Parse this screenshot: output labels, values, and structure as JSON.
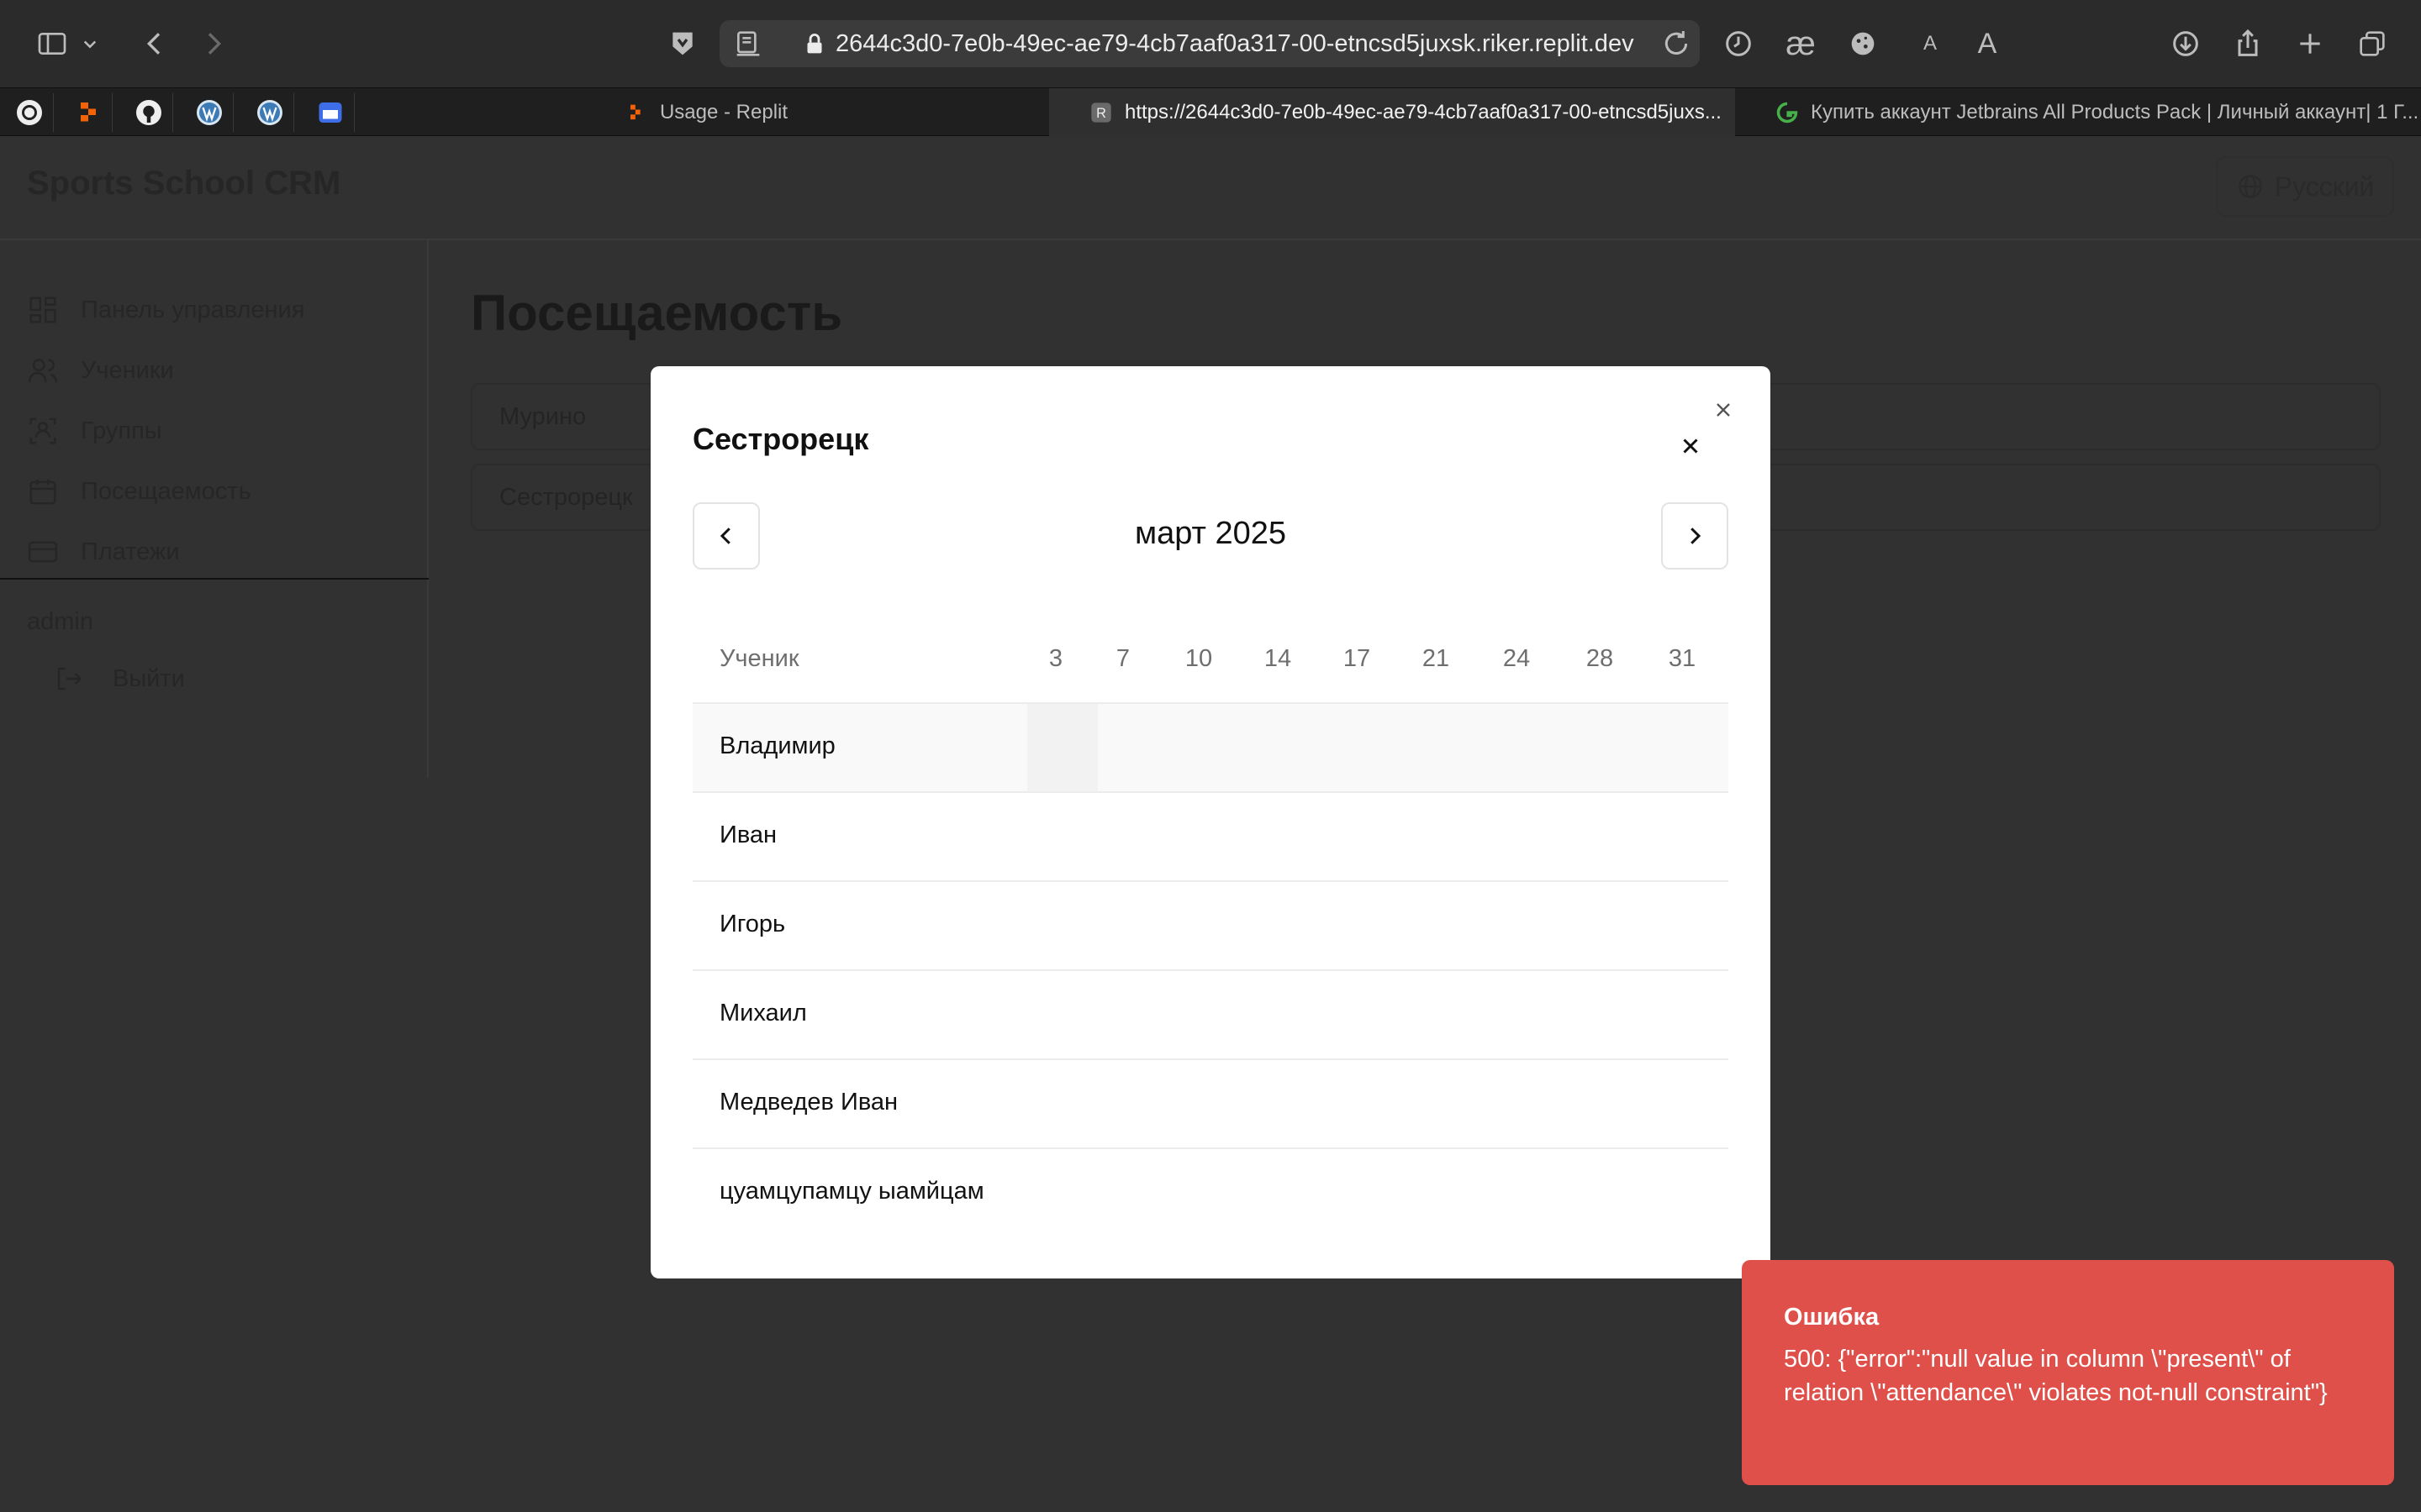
{
  "browser": {
    "url": "2644c3d0-7e0b-49ec-ae79-4cb7aaf0a317-00-etncsd5juxsk.riker.replit.dev",
    "tabs": [
      {
        "title": "Usage - Replit",
        "active": false
      },
      {
        "title": "https://2644c3d0-7e0b-49ec-ae79-4cb7aaf0a317-00-etncsd5juxs...",
        "active": true
      },
      {
        "title": "Купить аккаунт Jetbrains All Products Pack | Личный аккаунт| 1 Г...",
        "active": false
      }
    ],
    "toolbar_icons": [
      "sidebar-toggle-icon",
      "chevron-down-icon",
      "back-icon",
      "forward-icon",
      "shield-extension-icon",
      "reader-icon",
      "lock-icon",
      "reload-icon",
      "history-icon",
      "ae-extension-icon",
      "cookie-icon",
      "font-small-icon",
      "font-large-icon",
      "download-icon",
      "share-icon",
      "new-tab-icon",
      "tab-overview-icon"
    ],
    "text_smaller": "A",
    "text_larger": "A",
    "ae_label": "æ",
    "tab_fav_letter": "R"
  },
  "app": {
    "brand": "Sports School CRM",
    "language": "Русский",
    "nav": [
      {
        "label": "Панель управления",
        "icon": "dashboard-icon"
      },
      {
        "label": "Ученики",
        "icon": "users-icon"
      },
      {
        "label": "Группы",
        "icon": "groups-icon"
      },
      {
        "label": "Посещаемость",
        "icon": "calendar-icon"
      },
      {
        "label": "Платежи",
        "icon": "card-icon"
      }
    ],
    "user": "admin",
    "logout": "Выйти",
    "page_title": "Посещаемость",
    "groups": [
      "Мурино",
      "Сестрорецк"
    ]
  },
  "modal": {
    "title": "Сестрорецк",
    "month": "март 2025",
    "student_header": "Ученик",
    "days": [
      "3",
      "7",
      "10",
      "14",
      "17",
      "21",
      "24",
      "28",
      "31"
    ],
    "students": [
      "Владимир",
      "Иван",
      "Игорь",
      "Михаил",
      "Медведев Иван",
      "цуамцупамцу ыамйцам"
    ]
  },
  "toast": {
    "title": "Ошибка",
    "message": "500: {\"error\":\"null value in column \\\"present\\\" of relation \\\"attendance\\\" violates not-null constraint\"}",
    "color": "#e0504a"
  }
}
